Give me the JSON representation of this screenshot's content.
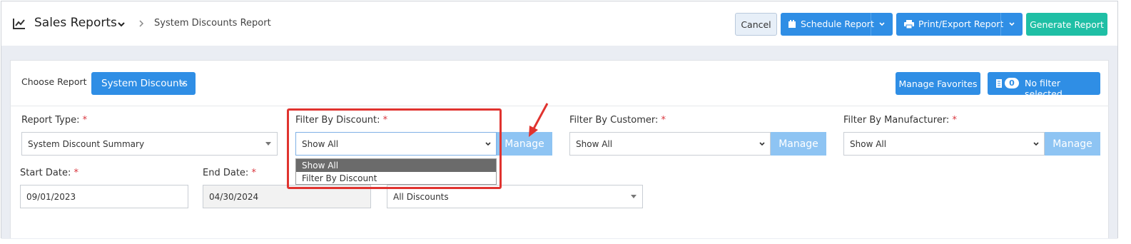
{
  "header": {
    "title": "Sales Reports",
    "breadcrumb": "System Discounts Report",
    "buttons": {
      "cancel": "Cancel",
      "schedule": "Schedule Report",
      "print_export": "Print/Export Report",
      "generate": "Generate Report"
    }
  },
  "toolbar": {
    "choose_report_label": "Choose Report",
    "choose_report_value": "System Discounts",
    "manage_favorites": "Manage Favorites",
    "filter_count": "0",
    "filter_status": "No filter selected"
  },
  "filters": {
    "report_type": {
      "label": "Report Type:",
      "value": "System Discount Summary"
    },
    "discount": {
      "label": "Filter By Discount:",
      "value": "Show All",
      "manage": "Manage",
      "options": [
        "Show All",
        "Filter By Discount"
      ]
    },
    "customer": {
      "label": "Filter By Customer:",
      "value": "Show All",
      "manage": "Manage"
    },
    "manufacturer": {
      "label": "Filter By Manufacturer:",
      "value": "Show All",
      "manage": "Manage"
    },
    "start_date": {
      "label": "Start Date:",
      "value": "09/01/2023"
    },
    "end_date": {
      "label": "End Date:",
      "value": "04/30/2024"
    },
    "discounts_select": {
      "value": "All Discounts"
    },
    "required_mark": "*"
  },
  "colors": {
    "primary": "#2f8ee5",
    "manage_light": "#8ec4f3",
    "generate": "#1fbfa5",
    "highlight": "#e0332f",
    "required": "#d9363e"
  }
}
